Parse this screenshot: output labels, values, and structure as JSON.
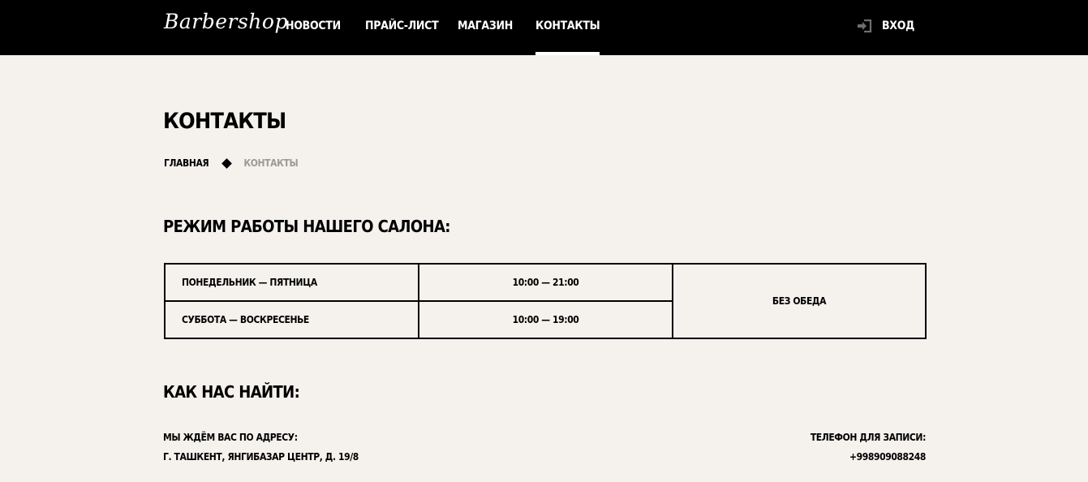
{
  "header": {
    "logo": "Barbershop",
    "nav": [
      {
        "label": "НОВОСТИ",
        "active": false
      },
      {
        "label": "ПРАЙС-ЛИСТ",
        "active": false
      },
      {
        "label": "МАГАЗИН",
        "active": false
      },
      {
        "label": "КОНТАКТЫ",
        "active": true
      }
    ],
    "login_label": "ВХОД",
    "login_icon": "login-icon"
  },
  "page": {
    "title": "КОНТАКТЫ",
    "breadcrumb": {
      "home": "ГЛАВНАЯ",
      "current": "КОНТАКТЫ",
      "separator_icon": "diamond-icon"
    }
  },
  "schedule": {
    "title": "РЕЖИМ РАБОТЫ НАШЕГО САЛОНА:",
    "rows": [
      {
        "days": "ПОНЕДЕЛЬНИК — ПЯТНИЦА",
        "hours": "10:00 — 21:00"
      },
      {
        "days": "СУББОТА — ВОСКРЕСЕНЬЕ",
        "hours": "10:00 — 19:00"
      }
    ],
    "note": "БЕЗ ОБЕДА"
  },
  "location": {
    "title": "КАК НАС НАЙТИ:",
    "address_label": "МЫ ЖДЁМ ВАС ПО АДРЕСУ:",
    "address": "Г. ТАШКЕНТ, ЯНГИБАЗАР ЦЕНТР, Д. 19/8",
    "phone_label": "ТЕЛЕФОН ДЛЯ ЗАПИСИ:",
    "phone": "+998909088248"
  },
  "colors": {
    "header_bg": "#000000",
    "page_bg": "#f5f2ee",
    "text": "#000000",
    "muted": "#9d9a96"
  }
}
